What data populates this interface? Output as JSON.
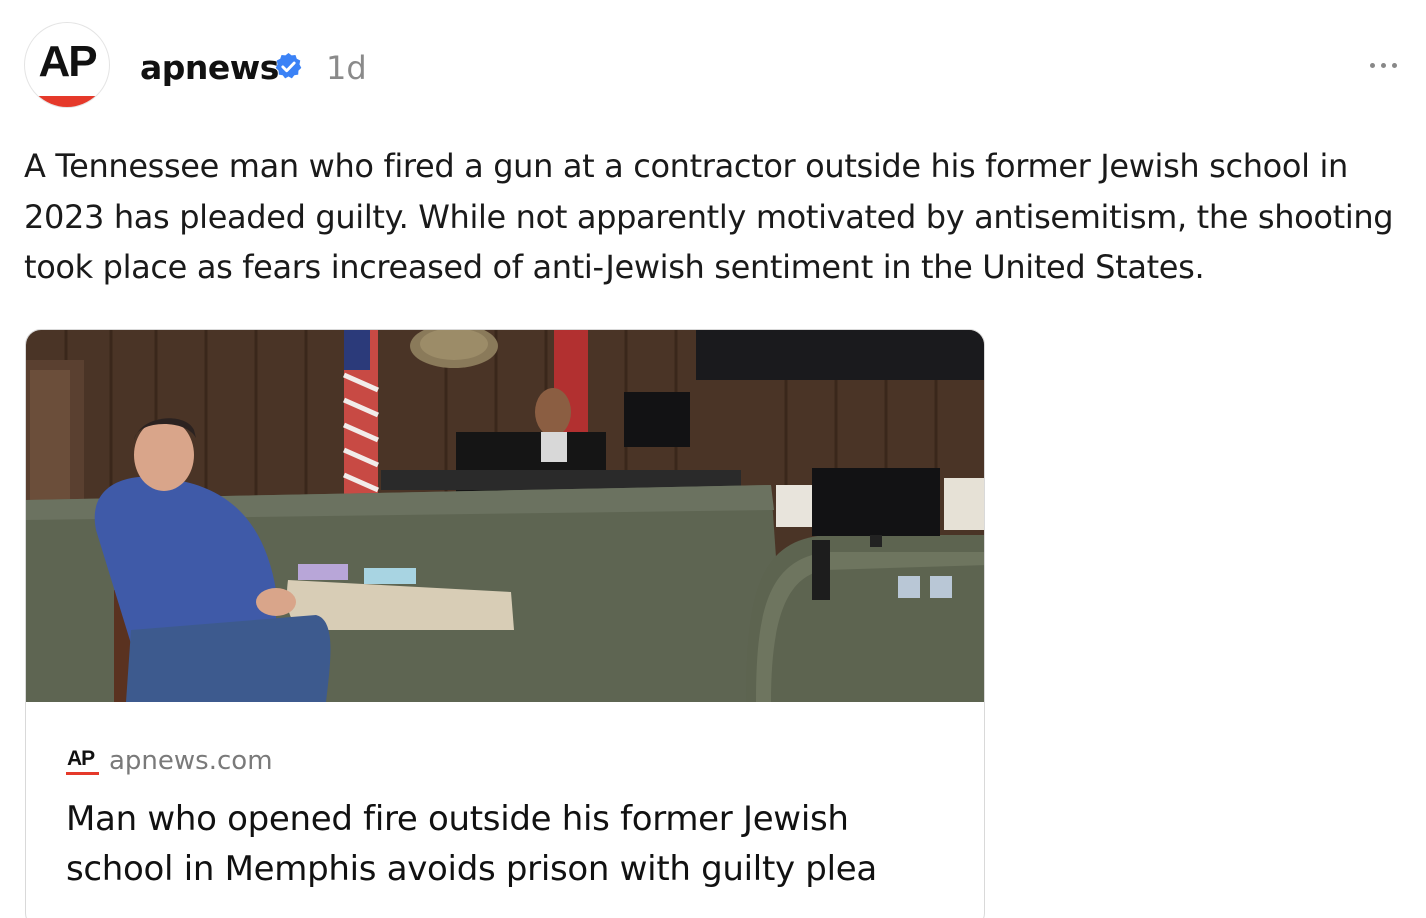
{
  "post": {
    "author": {
      "avatar_text": "AP",
      "username": "apnews",
      "verified": true,
      "time": "1d"
    },
    "text": "A Tennessee man who fired a gun at a contractor outside his former Jewish school in 2023 has pleaded guilty. While not apparently motivated by antisemitism, the shooting took place as fears increased of anti-Jewish sentiment in the United States.",
    "link_card": {
      "source_logo_text": "AP",
      "domain": "apnews.com",
      "title": "Man who opened fire outside his former Jewish school in Memphis avoids prison with guilty plea"
    }
  },
  "colors": {
    "brand_red": "#e5392a",
    "verified_blue": "#3b82f6",
    "muted_text": "#8a8a8a"
  },
  "icons": [
    "ap-logo-icon",
    "verified-badge-icon",
    "more-options-icon"
  ]
}
